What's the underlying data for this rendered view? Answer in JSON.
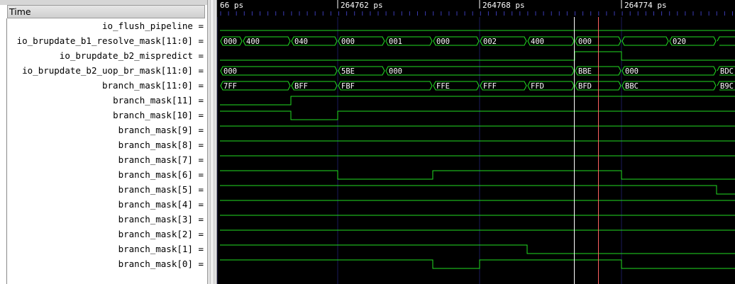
{
  "header": {
    "time_label": "Time"
  },
  "timeline": {
    "ticks": [
      {
        "label": "66 ps",
        "partial": true
      },
      {
        "label": "264762 ps"
      },
      {
        "label": "264768 ps"
      },
      {
        "label": "264774 ps"
      }
    ]
  },
  "signals": [
    {
      "name": "io_flush_pipeline =",
      "type": "bit"
    },
    {
      "name": "io_brupdate_b1_resolve_mask[11:0] =",
      "type": "bus",
      "segments": [
        "000",
        "400",
        "040",
        "000",
        "001",
        "000",
        "002",
        "400",
        "000",
        "",
        "020",
        ""
      ]
    },
    {
      "name": "io_brupdate_b2_mispredict =",
      "type": "bit"
    },
    {
      "name": "io_brupdate_b2_uop_br_mask[11:0] =",
      "type": "bus",
      "segments": [
        "000",
        "5BE",
        "000",
        "BBE",
        "000",
        "BDC"
      ]
    },
    {
      "name": "branch_mask[11:0] =",
      "type": "bus",
      "segments": [
        "7FF",
        "BFF",
        "FBF",
        "FFE",
        "FFF",
        "FFD",
        "BFD",
        "BBC",
        "B9C"
      ]
    },
    {
      "name": "branch_mask[11] =",
      "type": "bit"
    },
    {
      "name": "branch_mask[10] =",
      "type": "bit"
    },
    {
      "name": "branch_mask[9] =",
      "type": "bit"
    },
    {
      "name": "branch_mask[8] =",
      "type": "bit"
    },
    {
      "name": "branch_mask[7] =",
      "type": "bit"
    },
    {
      "name": "branch_mask[6] =",
      "type": "bit"
    },
    {
      "name": "branch_mask[5] =",
      "type": "bit"
    },
    {
      "name": "branch_mask[4] =",
      "type": "bit"
    },
    {
      "name": "branch_mask[3] =",
      "type": "bit"
    },
    {
      "name": "branch_mask[2] =",
      "type": "bit"
    },
    {
      "name": "branch_mask[1] =",
      "type": "bit"
    },
    {
      "name": "branch_mask[0] =",
      "type": "bit"
    }
  ],
  "colors": {
    "wave": "#22dd22",
    "grid": "#1a1a5a",
    "cursor_primary": "#ffffff",
    "cursor_marker": "#ff6060",
    "text": "#ffffff"
  }
}
